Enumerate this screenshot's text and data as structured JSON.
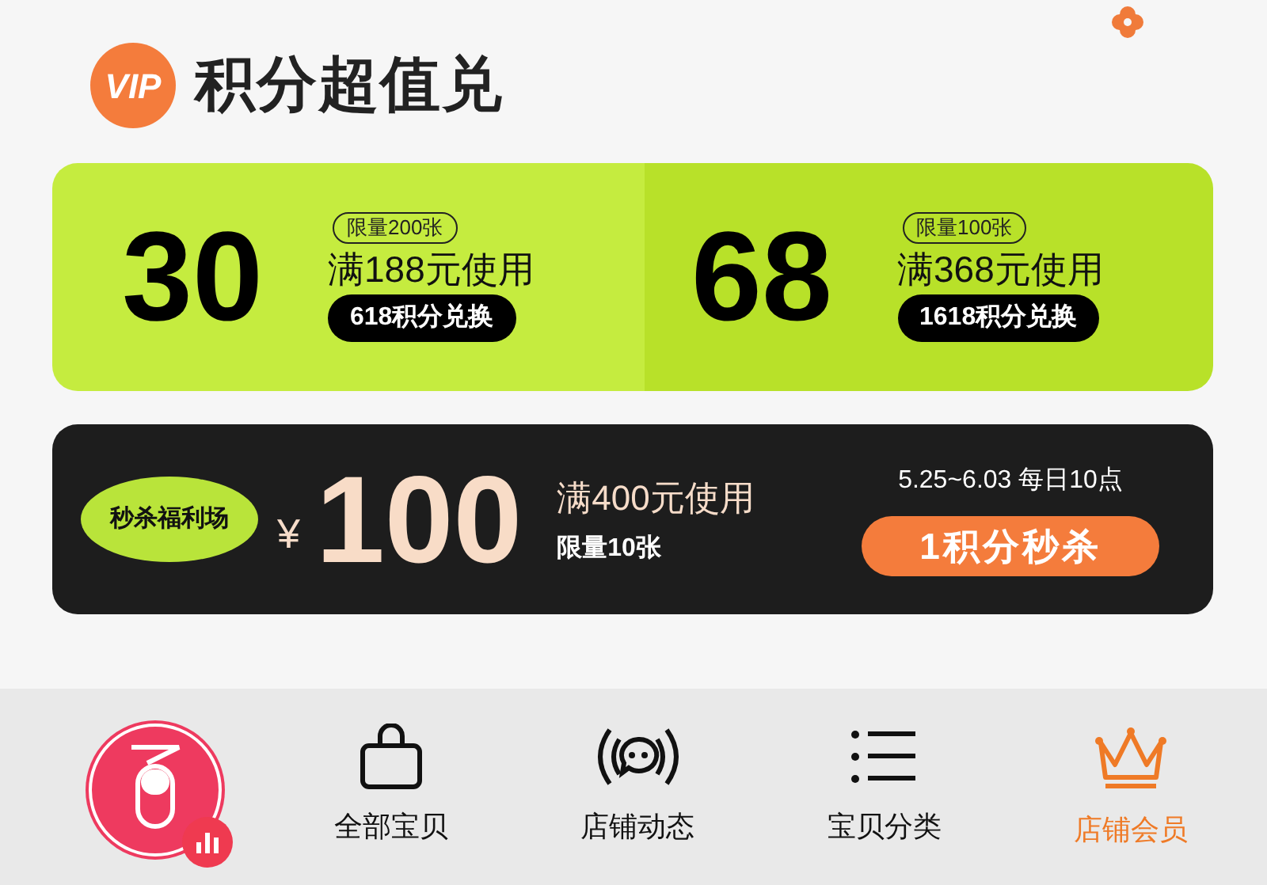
{
  "header": {
    "badge": "VIP",
    "title": "积分超值兑"
  },
  "coupons": [
    {
      "amount": "30",
      "limit": "限量200张",
      "condition": "满188元使用",
      "exchange": "618积分兑换"
    },
    {
      "amount": "68",
      "limit": "限量100张",
      "condition": "满368元使用",
      "exchange": "1618积分兑换"
    }
  ],
  "flash_sale": {
    "tag": "秒杀福利场",
    "currency": "¥",
    "amount": "100",
    "condition": "满400元使用",
    "limit": "限量10张",
    "schedule": "5.25~6.03 每日10点",
    "button": "1积分秒杀"
  },
  "tab_bar": [
    {
      "kind": "bag",
      "label": "全部宝贝",
      "selected": false
    },
    {
      "kind": "broadcast",
      "label": "店铺动态",
      "selected": false
    },
    {
      "kind": "list",
      "label": "宝贝分类",
      "selected": false
    },
    {
      "kind": "crown",
      "label": "店铺会员",
      "selected": true
    }
  ]
}
